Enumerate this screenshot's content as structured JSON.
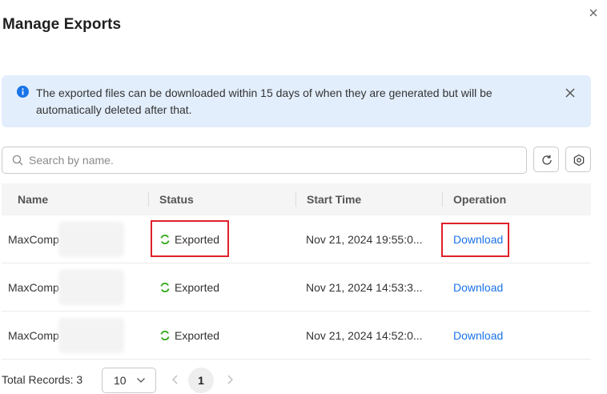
{
  "dialog": {
    "title": "Manage Exports"
  },
  "alert": {
    "text": "The exported files can be downloaded within 15 days of when they are generated but will be automatically deleted after that.",
    "accent_color": "#1a73e8",
    "background_color": "#e3eefc"
  },
  "search": {
    "placeholder": "Search by name."
  },
  "toolbar": {
    "refresh_icon": "refresh-icon",
    "settings_icon": "settings-icon"
  },
  "table": {
    "columns": [
      "Name",
      "Status",
      "Start Time",
      "Operation"
    ],
    "rows": [
      {
        "name": "MaxComp",
        "status": "Exported",
        "start_time": "Nov 21, 2024 19:55:0...",
        "operation": "Download"
      },
      {
        "name": "MaxComp",
        "status": "Exported",
        "start_time": "Nov 21, 2024 14:53:3...",
        "operation": "Download"
      },
      {
        "name": "MaxComp",
        "status": "Exported",
        "start_time": "Nov 21, 2024 14:52:0...",
        "operation": "Download"
      }
    ],
    "status_color": "#3fae29",
    "link_color": "#1a73e8"
  },
  "pagination": {
    "total_label": "Total Records: 3",
    "page_size": "10",
    "current_page": "1"
  },
  "highlight_color": "#e0202a"
}
